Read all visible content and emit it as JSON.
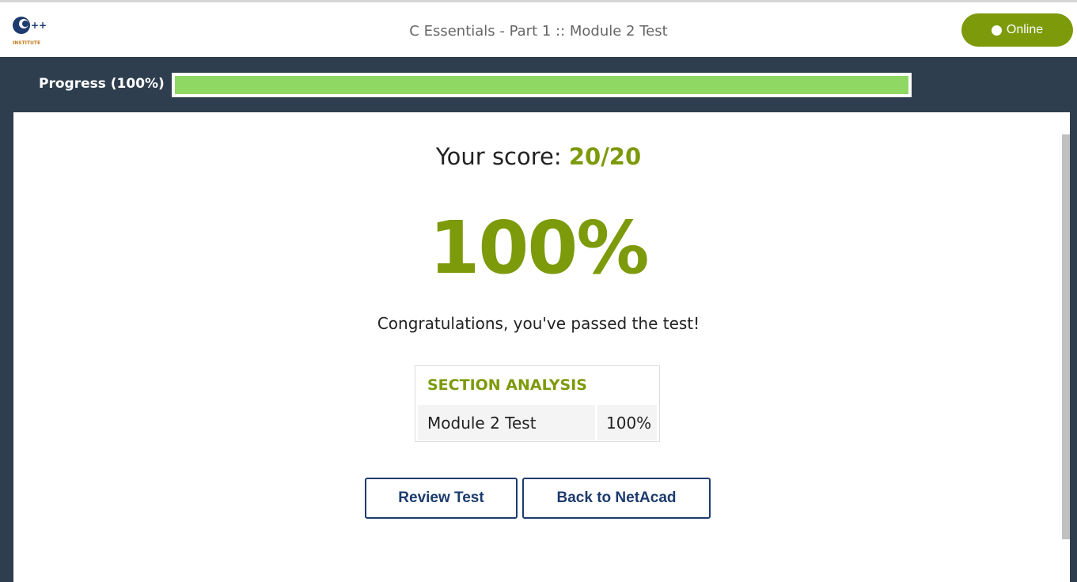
{
  "header": {
    "logo_icon": "cpp-institute-logo",
    "logo_text": "INSTITUTE",
    "title": "C Essentials - Part 1 :: Module 2 Test",
    "status_label": "Online"
  },
  "progress": {
    "label": "Progress (100%)",
    "value": 1.0
  },
  "result": {
    "score_label": "Your score: ",
    "score_value": "20/20",
    "percent": "100%",
    "message": "Congratulations, you've passed the test!"
  },
  "analysis": {
    "title": "SECTION ANALYSIS",
    "rows": [
      {
        "name": "Module 2 Test",
        "value": "100%"
      }
    ]
  },
  "actions": {
    "review_label": "Review Test",
    "back_label": "Back to NetAcad"
  },
  "colors": {
    "accent": "#7c9a0a",
    "progress_fill": "#8fd864",
    "navy": "#2e3e4e",
    "button_text": "#1d3b6e"
  }
}
